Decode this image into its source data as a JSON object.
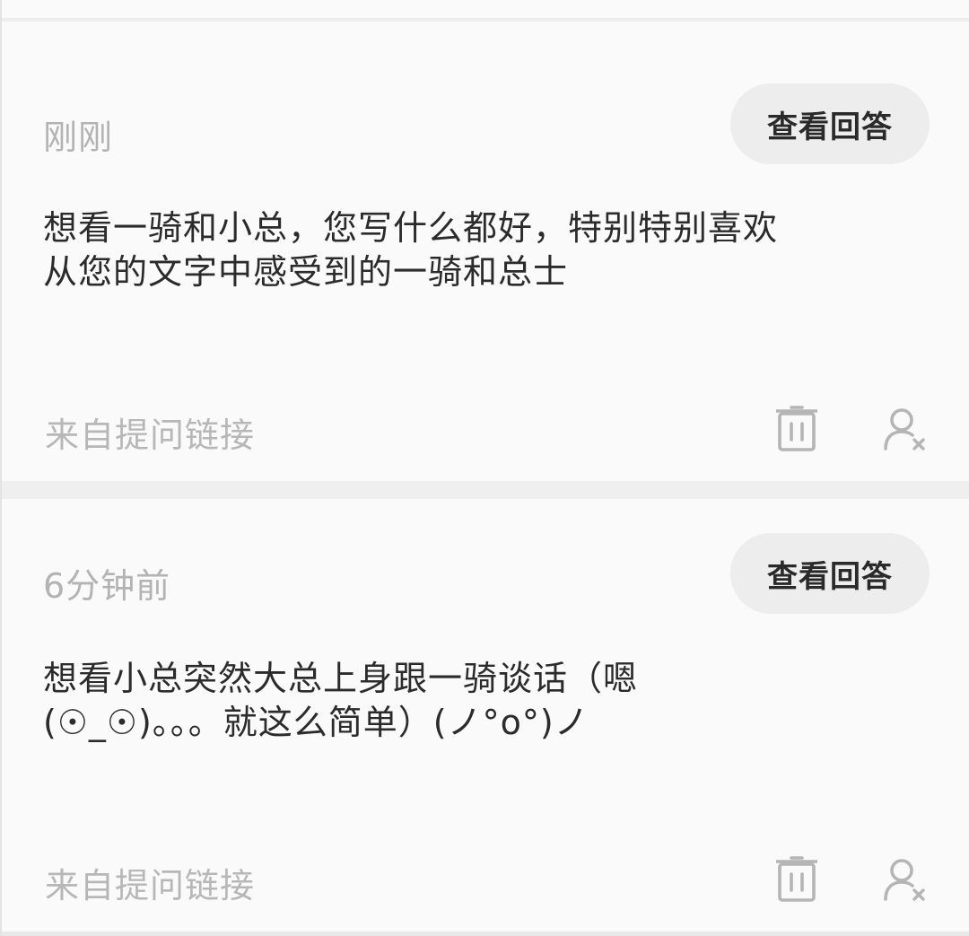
{
  "colors": {
    "background": "#fafafa",
    "separator": "#efefef",
    "primary_text": "#2b2b2b",
    "muted_text": "#b3b3b3",
    "button_bg": "#ededed",
    "icon": "#b5b5b5"
  },
  "questions": [
    {
      "time": "刚刚",
      "view_button": "查看回答",
      "text": "想看一骑和小总，您写什么都好，特别特别喜欢从您的文字中感受到的一骑和总士",
      "source": "来自提问链接",
      "icons": {
        "delete": "trash-icon",
        "block": "block-user-icon"
      }
    },
    {
      "time": "6分钟前",
      "view_button": "查看回答",
      "text": "想看小总突然大总上身跟一骑谈话（嗯(☉_☉)。。。就这么简单）(ノ°ο°)ノ",
      "source": "来自提问链接",
      "icons": {
        "delete": "trash-icon",
        "block": "block-user-icon"
      }
    }
  ]
}
